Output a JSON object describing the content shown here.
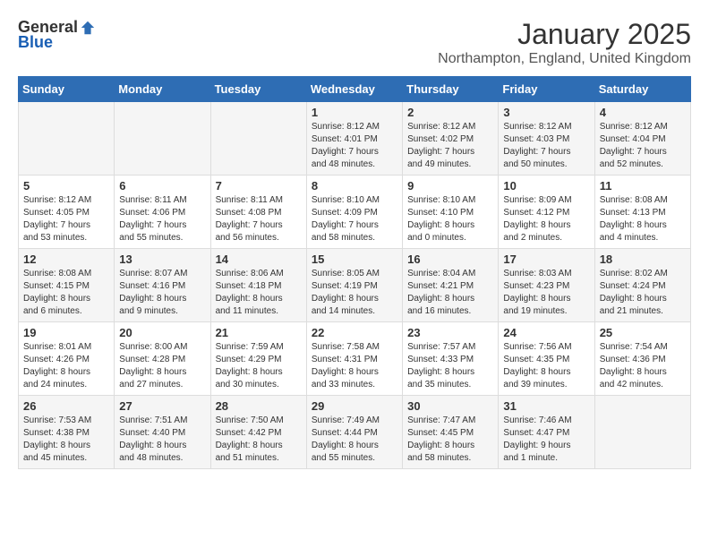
{
  "logo": {
    "general": "General",
    "blue": "Blue"
  },
  "title": "January 2025",
  "subtitle": "Northampton, England, United Kingdom",
  "days_of_week": [
    "Sunday",
    "Monday",
    "Tuesday",
    "Wednesday",
    "Thursday",
    "Friday",
    "Saturday"
  ],
  "weeks": [
    [
      {
        "day": "",
        "info": ""
      },
      {
        "day": "",
        "info": ""
      },
      {
        "day": "",
        "info": ""
      },
      {
        "day": "1",
        "info": "Sunrise: 8:12 AM\nSunset: 4:01 PM\nDaylight: 7 hours\nand 48 minutes."
      },
      {
        "day": "2",
        "info": "Sunrise: 8:12 AM\nSunset: 4:02 PM\nDaylight: 7 hours\nand 49 minutes."
      },
      {
        "day": "3",
        "info": "Sunrise: 8:12 AM\nSunset: 4:03 PM\nDaylight: 7 hours\nand 50 minutes."
      },
      {
        "day": "4",
        "info": "Sunrise: 8:12 AM\nSunset: 4:04 PM\nDaylight: 7 hours\nand 52 minutes."
      }
    ],
    [
      {
        "day": "5",
        "info": "Sunrise: 8:12 AM\nSunset: 4:05 PM\nDaylight: 7 hours\nand 53 minutes."
      },
      {
        "day": "6",
        "info": "Sunrise: 8:11 AM\nSunset: 4:06 PM\nDaylight: 7 hours\nand 55 minutes."
      },
      {
        "day": "7",
        "info": "Sunrise: 8:11 AM\nSunset: 4:08 PM\nDaylight: 7 hours\nand 56 minutes."
      },
      {
        "day": "8",
        "info": "Sunrise: 8:10 AM\nSunset: 4:09 PM\nDaylight: 7 hours\nand 58 minutes."
      },
      {
        "day": "9",
        "info": "Sunrise: 8:10 AM\nSunset: 4:10 PM\nDaylight: 8 hours\nand 0 minutes."
      },
      {
        "day": "10",
        "info": "Sunrise: 8:09 AM\nSunset: 4:12 PM\nDaylight: 8 hours\nand 2 minutes."
      },
      {
        "day": "11",
        "info": "Sunrise: 8:08 AM\nSunset: 4:13 PM\nDaylight: 8 hours\nand 4 minutes."
      }
    ],
    [
      {
        "day": "12",
        "info": "Sunrise: 8:08 AM\nSunset: 4:15 PM\nDaylight: 8 hours\nand 6 minutes."
      },
      {
        "day": "13",
        "info": "Sunrise: 8:07 AM\nSunset: 4:16 PM\nDaylight: 8 hours\nand 9 minutes."
      },
      {
        "day": "14",
        "info": "Sunrise: 8:06 AM\nSunset: 4:18 PM\nDaylight: 8 hours\nand 11 minutes."
      },
      {
        "day": "15",
        "info": "Sunrise: 8:05 AM\nSunset: 4:19 PM\nDaylight: 8 hours\nand 14 minutes."
      },
      {
        "day": "16",
        "info": "Sunrise: 8:04 AM\nSunset: 4:21 PM\nDaylight: 8 hours\nand 16 minutes."
      },
      {
        "day": "17",
        "info": "Sunrise: 8:03 AM\nSunset: 4:23 PM\nDaylight: 8 hours\nand 19 minutes."
      },
      {
        "day": "18",
        "info": "Sunrise: 8:02 AM\nSunset: 4:24 PM\nDaylight: 8 hours\nand 21 minutes."
      }
    ],
    [
      {
        "day": "19",
        "info": "Sunrise: 8:01 AM\nSunset: 4:26 PM\nDaylight: 8 hours\nand 24 minutes."
      },
      {
        "day": "20",
        "info": "Sunrise: 8:00 AM\nSunset: 4:28 PM\nDaylight: 8 hours\nand 27 minutes."
      },
      {
        "day": "21",
        "info": "Sunrise: 7:59 AM\nSunset: 4:29 PM\nDaylight: 8 hours\nand 30 minutes."
      },
      {
        "day": "22",
        "info": "Sunrise: 7:58 AM\nSunset: 4:31 PM\nDaylight: 8 hours\nand 33 minutes."
      },
      {
        "day": "23",
        "info": "Sunrise: 7:57 AM\nSunset: 4:33 PM\nDaylight: 8 hours\nand 35 minutes."
      },
      {
        "day": "24",
        "info": "Sunrise: 7:56 AM\nSunset: 4:35 PM\nDaylight: 8 hours\nand 39 minutes."
      },
      {
        "day": "25",
        "info": "Sunrise: 7:54 AM\nSunset: 4:36 PM\nDaylight: 8 hours\nand 42 minutes."
      }
    ],
    [
      {
        "day": "26",
        "info": "Sunrise: 7:53 AM\nSunset: 4:38 PM\nDaylight: 8 hours\nand 45 minutes."
      },
      {
        "day": "27",
        "info": "Sunrise: 7:51 AM\nSunset: 4:40 PM\nDaylight: 8 hours\nand 48 minutes."
      },
      {
        "day": "28",
        "info": "Sunrise: 7:50 AM\nSunset: 4:42 PM\nDaylight: 8 hours\nand 51 minutes."
      },
      {
        "day": "29",
        "info": "Sunrise: 7:49 AM\nSunset: 4:44 PM\nDaylight: 8 hours\nand 55 minutes."
      },
      {
        "day": "30",
        "info": "Sunrise: 7:47 AM\nSunset: 4:45 PM\nDaylight: 8 hours\nand 58 minutes."
      },
      {
        "day": "31",
        "info": "Sunrise: 7:46 AM\nSunset: 4:47 PM\nDaylight: 9 hours\nand 1 minute."
      },
      {
        "day": "",
        "info": ""
      }
    ]
  ]
}
